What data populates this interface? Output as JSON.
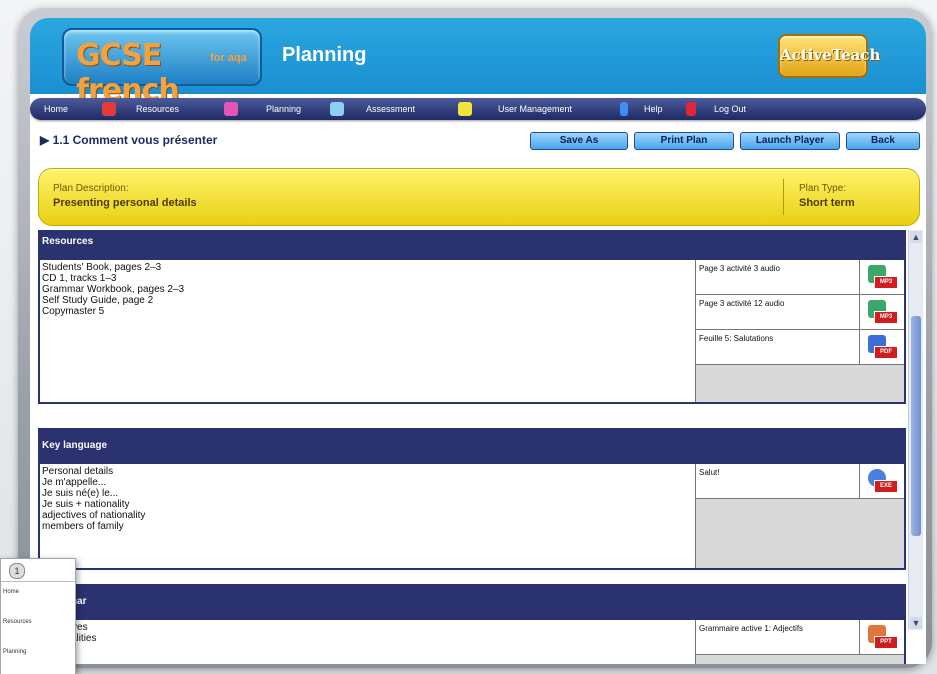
{
  "header": {
    "logo_main": "GCSE french",
    "logo_sub": "for aqa",
    "title": "Planning",
    "brand": "ActiveTeach"
  },
  "nav": {
    "items": [
      {
        "label": "Home",
        "icon": "home-icon"
      },
      {
        "label": "Resources",
        "icon": "resources-icon"
      },
      {
        "label": "Planning",
        "icon": "planning-icon"
      },
      {
        "label": "Assessment",
        "icon": "assessment-icon"
      },
      {
        "label": "User Management",
        "icon": "user-management-icon"
      },
      {
        "label": "Help",
        "icon": "help-icon"
      },
      {
        "label": "Log Out",
        "icon": "logout-icon"
      }
    ]
  },
  "page": {
    "title": "1.1 Comment vous présenter",
    "buttons": {
      "save_as": "Save As",
      "print_plan": "Print Plan",
      "launch_player": "Launch Player",
      "back": "Back"
    }
  },
  "plan": {
    "description_label": "Plan Description:",
    "description": "Presenting personal details",
    "type_label": "Plan Type:",
    "type": "Short term"
  },
  "sections": {
    "resources": {
      "title": "Resources",
      "text": "Students' Book, pages 2–3\nCD 1, tracks 1–3\nGrammar Workbook, pages 2–3\nSelf Study Guide, page 2\nCopymaster 5",
      "files": [
        {
          "name": "Page 3 activité 3 audio",
          "type": "MP3"
        },
        {
          "name": "Page 3 activité 12 audio",
          "type": "MP3"
        },
        {
          "name": "Feuille 5: Salutations",
          "type": "PDF"
        }
      ]
    },
    "key_language": {
      "title": "Key language",
      "text": "Personal details\nJe m'appelle...\nJe suis né(e) le...\nJe suis + nationality\nadjectives of nationality\nmembers of family",
      "files": [
        {
          "name": "Salut!",
          "type": "EXE"
        }
      ]
    },
    "grammar": {
      "title": "Grammar",
      "text": "Adjectives\nNationalities",
      "files": [
        {
          "name": "Grammaire active 1: Adjectifs",
          "type": "PPT"
        }
      ]
    }
  },
  "popup": {
    "number": "1",
    "items": [
      "Home",
      "Resources",
      "Planning"
    ]
  },
  "colors": {
    "header_blue": "#1b8fd1",
    "nav_navy": "#1f2a66",
    "section_navy": "#2a3270",
    "banner_yellow": "#f2dc2a",
    "button_blue": "#4aa5ea",
    "file_badge_red": "#d11d1d"
  }
}
